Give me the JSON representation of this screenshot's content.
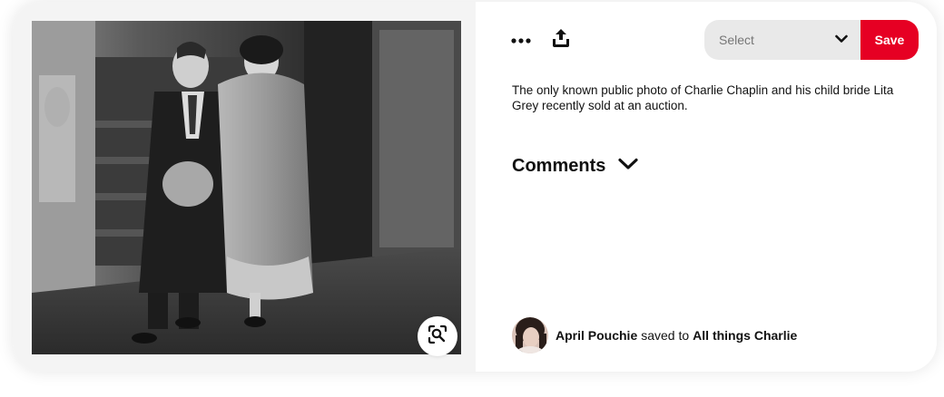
{
  "toolbar": {
    "more_icon": "ellipsis-icon",
    "share_icon": "share-upload-icon",
    "board_select_label": "Select",
    "save_label": "Save"
  },
  "pin": {
    "description": "The only known public photo of Charlie Chaplin and his child bride Lita Grey recently sold at an auction.",
    "image_alt_icon": "black-and-white-photo"
  },
  "comments": {
    "title": "Comments",
    "toggle_icon": "chevron-down-icon"
  },
  "attribution": {
    "user_name": "April Pouchie",
    "saved_to_text": "saved to",
    "board_name": "All things Charlie"
  },
  "colors": {
    "save_button": "#e60023",
    "select_background": "#e9e9e9",
    "text": "#111111"
  }
}
